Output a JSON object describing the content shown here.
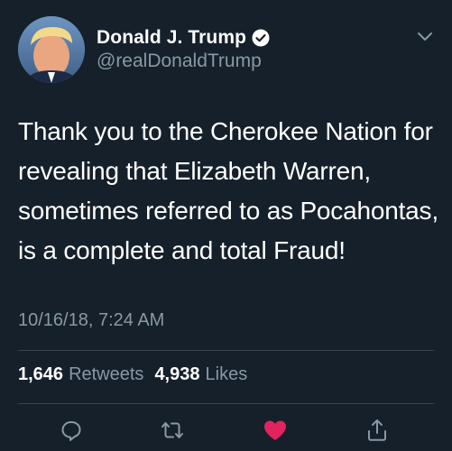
{
  "author": {
    "display_name": "Donald J. Trump",
    "handle": "@realDonaldTrump",
    "verified": true,
    "verified_icon": "verified-badge-icon"
  },
  "tweet": {
    "text": "Thank you to the Cherokee Nation for revealing that Elizabeth Warren, sometimes referred to as Pocahontas, is a complete and total Fraud!",
    "timestamp": "10/16/18, 7:24 AM"
  },
  "stats": {
    "retweets_count": "1,646",
    "retweets_label": "Retweets",
    "likes_count": "4,938",
    "likes_label": "Likes"
  },
  "actions": {
    "reply_icon": "reply-icon",
    "retweet_icon": "retweet-icon",
    "like_icon": "heart-icon",
    "share_icon": "share-icon",
    "liked": true
  },
  "colors": {
    "background": "#15202b",
    "text_primary": "#ffffff",
    "text_secondary": "#8899a6",
    "divider": "#38444d",
    "like_red": "#e0245e"
  }
}
